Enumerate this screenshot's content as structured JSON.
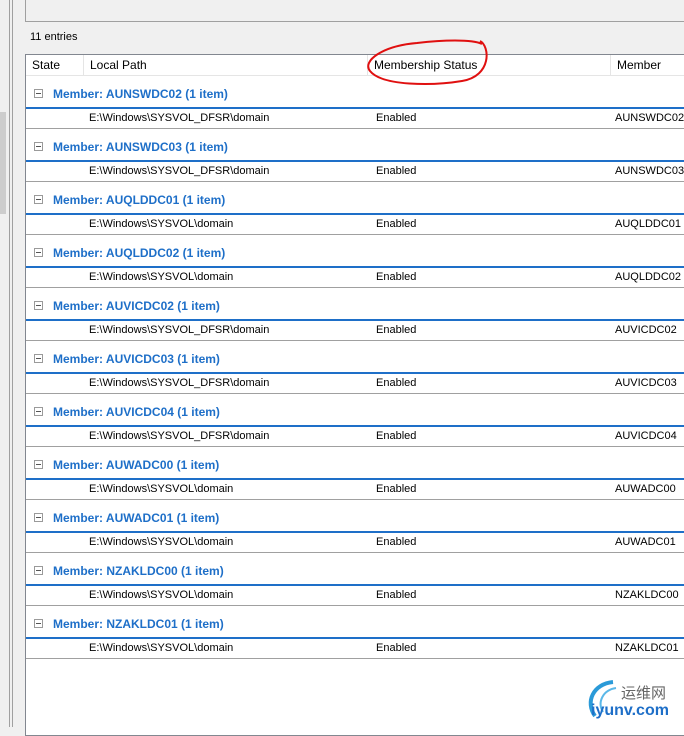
{
  "entries_label": "11 entries",
  "columns": [
    "State",
    "Local Path",
    "Membership Status",
    "Member"
  ],
  "groups": [
    {
      "title": "Member: AUNSWDC02 (1 item)",
      "path": "E:\\Windows\\SYSVOL_DFSR\\domain",
      "status": "Enabled",
      "member": "AUNSWDC02"
    },
    {
      "title": "Member: AUNSWDC03 (1 item)",
      "path": "E:\\Windows\\SYSVOL_DFSR\\domain",
      "status": "Enabled",
      "member": "AUNSWDC03"
    },
    {
      "title": "Member: AUQLDDC01 (1 item)",
      "path": "E:\\Windows\\SYSVOL\\domain",
      "status": "Enabled",
      "member": "AUQLDDC01"
    },
    {
      "title": "Member: AUQLDDC02 (1 item)",
      "path": "E:\\Windows\\SYSVOL\\domain",
      "status": "Enabled",
      "member": "AUQLDDC02"
    },
    {
      "title": "Member: AUVICDC02 (1 item)",
      "path": "E:\\Windows\\SYSVOL_DFSR\\domain",
      "status": "Enabled",
      "member": "AUVICDC02"
    },
    {
      "title": "Member: AUVICDC03 (1 item)",
      "path": "E:\\Windows\\SYSVOL_DFSR\\domain",
      "status": "Enabled",
      "member": "AUVICDC03"
    },
    {
      "title": "Member: AUVICDC04 (1 item)",
      "path": "E:\\Windows\\SYSVOL_DFSR\\domain",
      "status": "Enabled",
      "member": "AUVICDC04"
    },
    {
      "title": "Member: AUWADC00 (1 item)",
      "path": "E:\\Windows\\SYSVOL\\domain",
      "status": "Enabled",
      "member": "AUWADC00"
    },
    {
      "title": "Member: AUWADC01 (1 item)",
      "path": "E:\\Windows\\SYSVOL\\domain",
      "status": "Enabled",
      "member": "AUWADC01"
    },
    {
      "title": "Member: NZAKLDC00 (1 item)",
      "path": "E:\\Windows\\SYSVOL\\domain",
      "status": "Enabled",
      "member": "NZAKLDC00"
    },
    {
      "title": "Member: NZAKLDC01 (1 item)",
      "path": "E:\\Windows\\SYSVOL\\domain",
      "status": "Enabled",
      "member": "NZAKLDC01"
    }
  ],
  "watermark": {
    "cn": "运维网",
    "en": "iyunv.com"
  },
  "colors": {
    "group": "#1e6fc8",
    "annotation": "#e01010"
  }
}
